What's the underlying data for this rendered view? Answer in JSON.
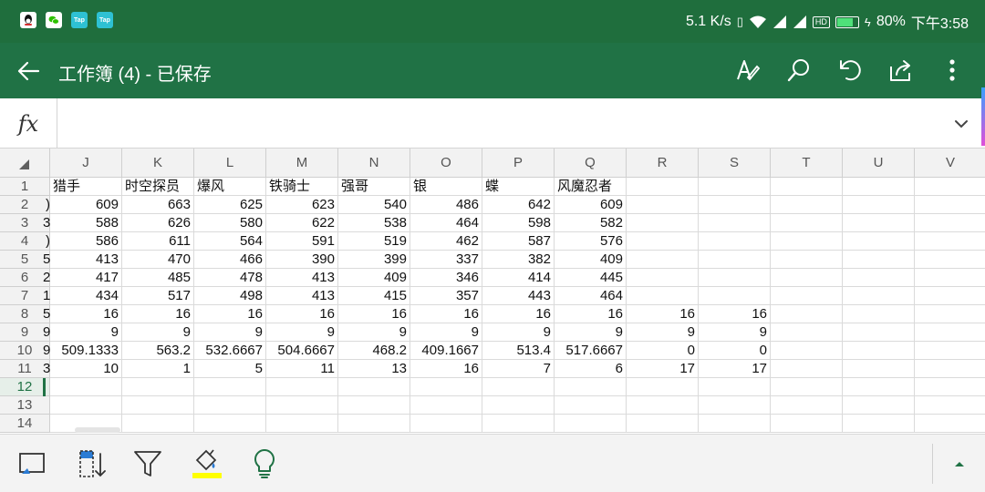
{
  "status_bar": {
    "apps": [
      {
        "icon": "qq-icon",
        "label": ""
      },
      {
        "icon": "wechat-icon",
        "label": ""
      },
      {
        "icon": "taptap-icon",
        "label": "Tap"
      },
      {
        "icon": "taptap-icon",
        "label": "Tap"
      }
    ],
    "net_speed": "5.1 K/s",
    "battery_percent": "80%",
    "battery_level": 0.8,
    "hd_label": "HD",
    "time": "下午3:58"
  },
  "app_bar": {
    "title": "工作簿 (4) - 已保存",
    "actions": [
      "draw-pen-icon",
      "search-icon",
      "undo-icon",
      "share-icon",
      "more-vertical-icon"
    ]
  },
  "formula_bar": {
    "fx_label": "fx",
    "value": ""
  },
  "grid": {
    "columns": [
      "J",
      "K",
      "L",
      "M",
      "N",
      "O",
      "P",
      "Q",
      "R",
      "S",
      "T",
      "U",
      "V"
    ],
    "row_numbers": [
      "1",
      "2",
      "3",
      "4",
      "5",
      "6",
      "7",
      "8",
      "9",
      "10",
      "11",
      "12",
      "13",
      "14"
    ],
    "active_row": "12",
    "left_fragments": [
      "",
      ")",
      "3",
      ")",
      "5",
      "2",
      "1",
      "5",
      "9",
      "9",
      "3"
    ],
    "header_row": [
      "猎手",
      "时空探员",
      "爆风",
      "铁骑士",
      "强哥",
      "银",
      "蝶",
      "风魔忍者",
      "",
      "",
      "",
      "",
      ""
    ],
    "data_rows": [
      [
        "609",
        "663",
        "625",
        "623",
        "540",
        "486",
        "642",
        "609",
        "",
        "",
        "",
        "",
        ""
      ],
      [
        "588",
        "626",
        "580",
        "622",
        "538",
        "464",
        "598",
        "582",
        "",
        "",
        "",
        "",
        ""
      ],
      [
        "586",
        "611",
        "564",
        "591",
        "519",
        "462",
        "587",
        "576",
        "",
        "",
        "",
        "",
        ""
      ],
      [
        "413",
        "470",
        "466",
        "390",
        "399",
        "337",
        "382",
        "409",
        "",
        "",
        "",
        "",
        ""
      ],
      [
        "417",
        "485",
        "478",
        "413",
        "409",
        "346",
        "414",
        "445",
        "",
        "",
        "",
        "",
        ""
      ],
      [
        "434",
        "517",
        "498",
        "413",
        "415",
        "357",
        "443",
        "464",
        "",
        "",
        "",
        "",
        ""
      ],
      [
        "16",
        "16",
        "16",
        "16",
        "16",
        "16",
        "16",
        "16",
        "16",
        "16",
        "",
        "",
        ""
      ],
      [
        "9",
        "9",
        "9",
        "9",
        "9",
        "9",
        "9",
        "9",
        "9",
        "9",
        "",
        "",
        ""
      ],
      [
        "509.1333",
        "563.2",
        "532.6667",
        "504.6667",
        "468.2",
        "409.1667",
        "513.4",
        "517.6667",
        "0",
        "0",
        "",
        "",
        ""
      ],
      [
        "10",
        "1",
        "5",
        "11",
        "13",
        "16",
        "7",
        "6",
        "17",
        "17",
        "",
        "",
        ""
      ]
    ]
  },
  "bottom_toolbar": {
    "tools": [
      "select-box-icon",
      "sort-icon",
      "filter-icon",
      "fill-color-icon",
      "ideas-bulb-icon"
    ],
    "fill_color": "#ffff00",
    "accent_color": "#207245",
    "expand": "chevron-up-icon"
  }
}
